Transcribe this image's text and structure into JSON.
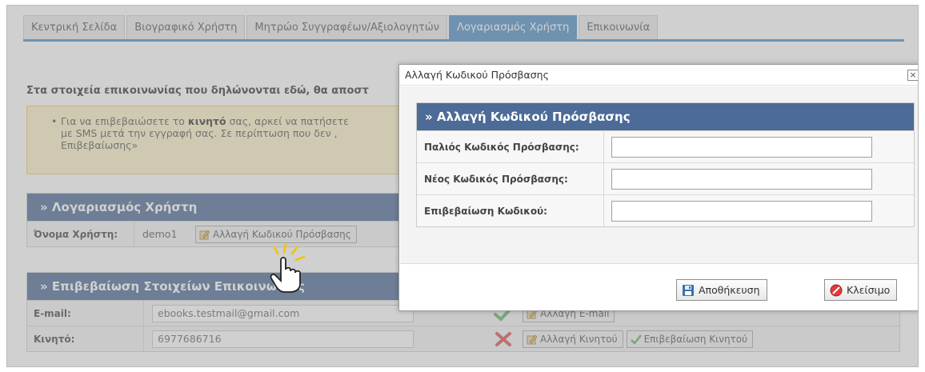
{
  "tabs": [
    {
      "label": "Κεντρική Σελίδα",
      "active": false
    },
    {
      "label": "Βιογραφικό Χρήστη",
      "active": false
    },
    {
      "label": "Μητρώο Συγγραφέων/Αξιολογητών",
      "active": false
    },
    {
      "label": "Λογαριασμός Χρήστη",
      "active": true
    },
    {
      "label": "Επικοινωνία",
      "active": false
    }
  ],
  "background": {
    "intro": "Στα στοιχεία επικοινωνίας που δηλώνονται εδώ, θα αποστ",
    "notice": {
      "line1_prefix": "Για να επιβεβαιώσετε το ",
      "line1_bold": "κινητό",
      "line1_suffix": " σας, αρκεί να πατήσετε",
      "line2": "με SMS μετά την εγγραφή σας. Σε περίπτωση που δεν ,",
      "line3": "Επιβεβαίωσης»"
    },
    "account": {
      "heading": "» Λογαριασμός Χρήστη",
      "username_label": "Όνομα Χρήστη:",
      "username_value": "demo1",
      "change_password_button": "Αλλαγή Κωδικού Πρόσβασης"
    },
    "contact": {
      "heading": "» Επιβεβαίωση Στοιχείων Επικοινωνίας",
      "email_label": "E-mail:",
      "email_value": "ebooks.testmail@gmail.com",
      "change_email_button": "Αλλαγή E-mail",
      "mobile_label": "Κινητό:",
      "mobile_value": "6977686716",
      "change_mobile_button": "Αλλαγή Κινητού",
      "confirm_mobile_button": "Επιβεβαίωση Κινητού"
    }
  },
  "dialog": {
    "title": "Αλλαγή Κωδικού Πρόσβασης",
    "close_glyph": "×",
    "heading": "» Αλλαγή Κωδικού Πρόσβασης",
    "fields": [
      {
        "label": "Παλιός Κωδικός Πρόσβασης:",
        "value": ""
      },
      {
        "label": "Νέος Κωδικός Πρόσβασης:",
        "value": ""
      },
      {
        "label": "Επιβεβαίωση Κωδικού:",
        "value": ""
      }
    ],
    "save_label": "Αποθήκευση",
    "close_label": "Κλείσιμο"
  },
  "colors": {
    "accent": "#4f8fc6",
    "section_header": "#4c6b96",
    "notice_bg": "#fdf3c8",
    "check_green": "#5cb85c",
    "cross_red": "#d9534f"
  }
}
